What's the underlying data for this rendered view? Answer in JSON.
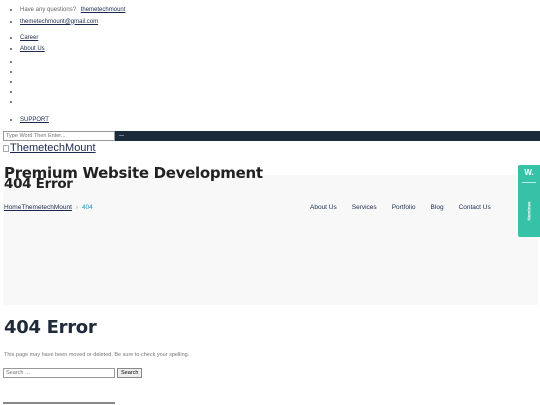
{
  "topbar": {
    "question": "Have any questions?",
    "username": "themetechmount",
    "email": "themetechmount@gmail.com"
  },
  "menu1": {
    "items": [
      "Career",
      "About Us"
    ]
  },
  "empty_bullets": 5,
  "support": "SUPPORT",
  "top_search": {
    "placeholder": "Type Word Then Enter...",
    "button": "—"
  },
  "logo_alt": "ThemetechMount",
  "tagline": "Premium Website Development",
  "band_title": "404 Error",
  "breadcrumb": {
    "home": "Home",
    "site": "ThemetechMount",
    "separator": "›",
    "current": "404"
  },
  "nav": [
    "About Us",
    "Services",
    "Portfolio",
    "Blog",
    "Contact Us"
  ],
  "main_title": "404 Error",
  "message": "This page may have been moved or deleted. Be sure to check your spelling.",
  "search": {
    "placeholder": "Search …",
    "button": "Search"
  },
  "side_badge": {
    "mark": "W.",
    "label": "Nominee"
  },
  "colors": {
    "badge": "#36c2a7",
    "dark_bar": "#1c2b3a",
    "link": "#1b2a4e",
    "current_crumb": "#2c8fc9"
  }
}
